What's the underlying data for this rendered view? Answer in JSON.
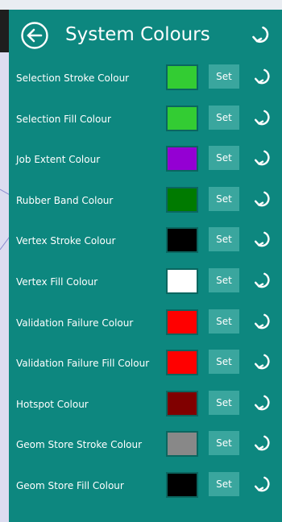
{
  "header": {
    "title": "System Colours"
  },
  "icons": {
    "back": "back-arrow-icon",
    "reset": "reset-icon"
  },
  "rows": [
    {
      "label": "Selection Stroke Colour",
      "color": "#33cc33",
      "set_label": "Set"
    },
    {
      "label": "Selection Fill Colour",
      "color": "#33cc33",
      "set_label": "Set"
    },
    {
      "label": "Job Extent Colour",
      "color": "#9400d3",
      "set_label": "Set"
    },
    {
      "label": "Rubber Band Colour",
      "color": "#007a00",
      "set_label": "Set"
    },
    {
      "label": "Vertex Stroke Colour",
      "color": "#000000",
      "set_label": "Set"
    },
    {
      "label": "Vertex Fill Colour",
      "color": "#ffffff",
      "set_label": "Set"
    },
    {
      "label": "Validation Failure Colour",
      "color": "#ff0000",
      "set_label": "Set"
    },
    {
      "label": "Validation Failure Fill Colour",
      "color": "#ff0000",
      "set_label": "Set"
    },
    {
      "label": "Hotspot Colour",
      "color": "#800000",
      "set_label": "Set"
    },
    {
      "label": "Geom Store Stroke Colour",
      "color": "#888888",
      "set_label": "Set"
    },
    {
      "label": "Geom Store Fill Colour",
      "color": "#000000",
      "set_label": "Set"
    }
  ],
  "colors": {
    "panel_background": "#0d877f",
    "set_button": "#3aa69e"
  }
}
